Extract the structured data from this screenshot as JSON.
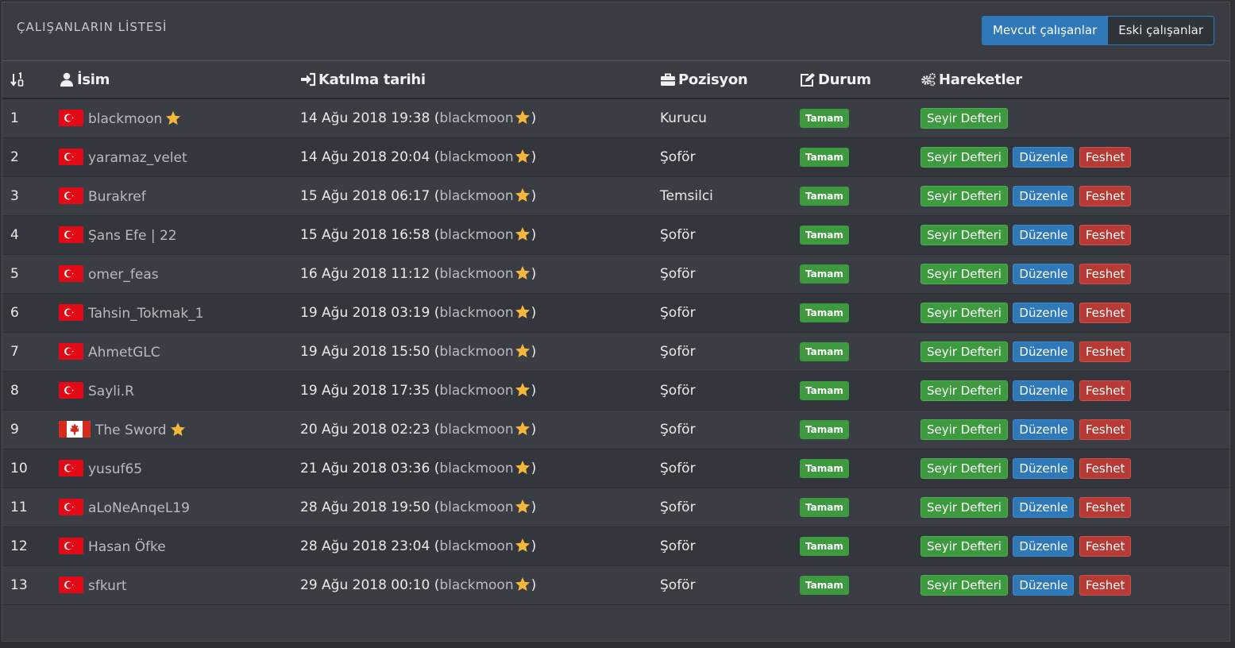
{
  "header": {
    "title": "ÇALIŞANLARIN LİSTESİ",
    "tabs": [
      {
        "label": "Mevcut çalışanlar",
        "active": true
      },
      {
        "label": "Eski çalışanlar",
        "active": false
      }
    ]
  },
  "columns": {
    "number": "",
    "name": "İsim",
    "joined": "Katılma tarihi",
    "position": "Pozisyon",
    "status": "Durum",
    "actions": "Hareketler"
  },
  "actions": {
    "logbook": "Seyir Defteri",
    "edit": "Düzenle",
    "fire": "Feshet"
  },
  "colors": {
    "green": "#3d9a3f",
    "blue": "#2f79b9",
    "red": "#b73a35",
    "star": "#f4b63b"
  },
  "rows": [
    {
      "no": "1",
      "name": "blackmoon",
      "flag": "tr",
      "star": true,
      "date": "14 Ağu 2018 19:38 (",
      "by": "blackmoon",
      "position": "Kurucu",
      "status": "Tamam",
      "full_actions": false
    },
    {
      "no": "2",
      "name": "yaramaz_velet",
      "flag": "tr",
      "star": false,
      "date": "14 Ağu 2018 20:04 (",
      "by": "blackmoon",
      "position": "Şoför",
      "status": "Tamam",
      "full_actions": true
    },
    {
      "no": "3",
      "name": "Burakref",
      "flag": "tr",
      "star": false,
      "date": "15 Ağu 2018 06:17 (",
      "by": "blackmoon",
      "position": "Temsilci",
      "status": "Tamam",
      "full_actions": true
    },
    {
      "no": "4",
      "name": "Şans Efe | 22",
      "flag": "tr",
      "star": false,
      "date": "15 Ağu 2018 16:58 (",
      "by": "blackmoon",
      "position": "Şoför",
      "status": "Tamam",
      "full_actions": true
    },
    {
      "no": "5",
      "name": "omer_feas",
      "flag": "tr",
      "star": false,
      "date": "16 Ağu 2018 11:12 (",
      "by": "blackmoon",
      "position": "Şoför",
      "status": "Tamam",
      "full_actions": true
    },
    {
      "no": "6",
      "name": "Tahsin_Tokmak_1",
      "flag": "tr",
      "star": false,
      "date": "19 Ağu 2018 03:19 (",
      "by": "blackmoon",
      "position": "Şoför",
      "status": "Tamam",
      "full_actions": true
    },
    {
      "no": "7",
      "name": "AhmetGLC",
      "flag": "tr",
      "star": false,
      "date": "19 Ağu 2018 15:50 (",
      "by": "blackmoon",
      "position": "Şoför",
      "status": "Tamam",
      "full_actions": true
    },
    {
      "no": "8",
      "name": "Sayli.R",
      "flag": "tr",
      "star": false,
      "date": "19 Ağu 2018 17:35 (",
      "by": "blackmoon",
      "position": "Şoför",
      "status": "Tamam",
      "full_actions": true
    },
    {
      "no": "9",
      "name": "The Sword",
      "flag": "ca",
      "star": true,
      "date": "20 Ağu 2018 02:23 (",
      "by": "blackmoon",
      "position": "Şoför",
      "status": "Tamam",
      "full_actions": true
    },
    {
      "no": "10",
      "name": "yusuf65",
      "flag": "tr",
      "star": false,
      "date": "21 Ağu 2018 03:36 (",
      "by": "blackmoon",
      "position": "Şoför",
      "status": "Tamam",
      "full_actions": true
    },
    {
      "no": "11",
      "name": "aLoNeAnqeL19",
      "flag": "tr",
      "star": false,
      "date": "28 Ağu 2018 19:50 (",
      "by": "blackmoon",
      "position": "Şoför",
      "status": "Tamam",
      "full_actions": true
    },
    {
      "no": "12",
      "name": "Hasan Öfke",
      "flag": "tr",
      "star": false,
      "date": "28 Ağu 2018 23:04 (",
      "by": "blackmoon",
      "position": "Şoför",
      "status": "Tamam",
      "full_actions": true
    },
    {
      "no": "13",
      "name": "sfkurt",
      "flag": "tr",
      "star": false,
      "date": "29 Ağu 2018 00:10 (",
      "by": "blackmoon",
      "position": "Şoför",
      "status": "Tamam",
      "full_actions": true
    }
  ]
}
